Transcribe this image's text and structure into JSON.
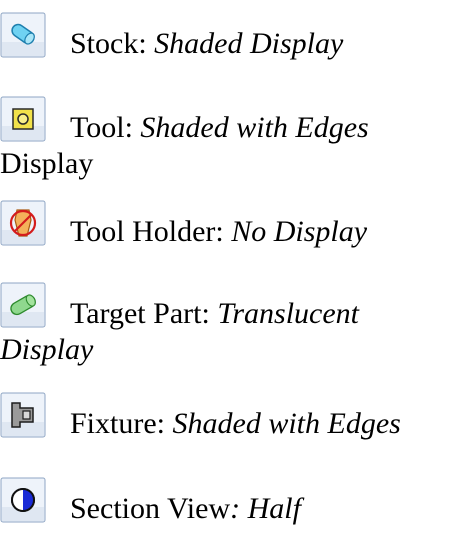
{
  "display_settings": [
    {
      "icon": "stock-shaded-icon",
      "label": "Stock:",
      "value": "Shaded Display",
      "continuation": ""
    },
    {
      "icon": "tool-shaded-edges-icon",
      "label": "Tool:",
      "value": "Shaded with Edges",
      "continuation": "Display"
    },
    {
      "icon": "tool-holder-no-display-icon",
      "label": "Tool Holder:",
      "value": "No Display",
      "continuation": ""
    },
    {
      "icon": "target-part-translucent-icon",
      "label": "Target Part:",
      "value": "Translucent",
      "continuation": "Display"
    },
    {
      "icon": "fixture-shaded-edges-icon",
      "label": "Fixture:",
      "value": "Shaded with Edges",
      "continuation": ""
    },
    {
      "icon": "section-view-half-icon",
      "label": "Section View",
      "label_suffix": ":",
      "value": "Half",
      "continuation": ""
    }
  ]
}
